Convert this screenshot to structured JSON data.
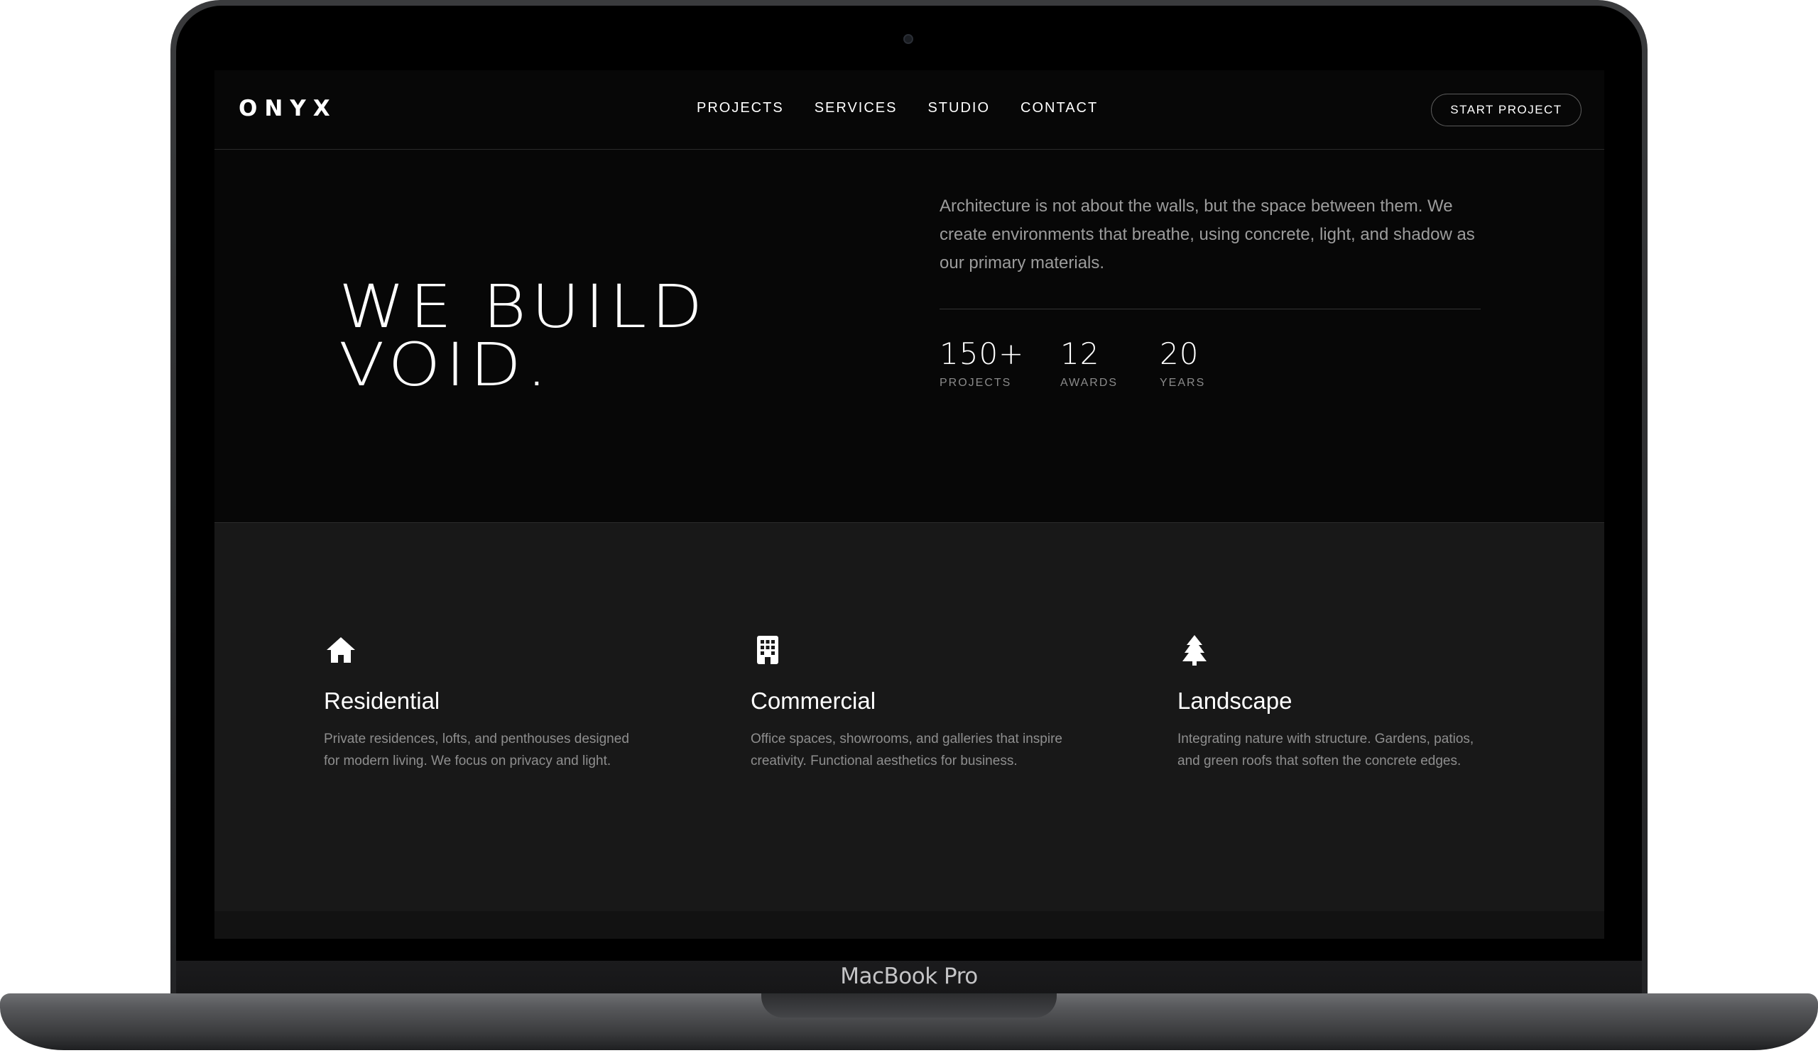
{
  "device": {
    "model_label": "MacBook Pro"
  },
  "nav": {
    "logo": "ONYX",
    "links": [
      "PROJECTS",
      "SERVICES",
      "STUDIO",
      "CONTACT"
    ],
    "cta": "START PROJECT"
  },
  "hero": {
    "title": "WE BUILD\nVOID.",
    "description": "Architecture is not about the walls, but the space between them. We create environments that breathe, using concrete, light, and shadow as our primary materials.",
    "stats": [
      {
        "value": "150+",
        "label": "PROJECTS"
      },
      {
        "value": "12",
        "label": "AWARDS"
      },
      {
        "value": "20",
        "label": "YEARS"
      }
    ]
  },
  "services": [
    {
      "icon": "house-icon",
      "title": "Residential",
      "description": "Private residences, lofts, and penthouses designed for modern living. We focus on privacy and light."
    },
    {
      "icon": "building-icon",
      "title": "Commercial",
      "description": "Office spaces, showrooms, and galleries that inspire creativity. Functional aesthetics for business."
    },
    {
      "icon": "tree-icon",
      "title": "Landscape",
      "description": "Integrating nature with structure. Gardens, patios, and green roofs that soften the concrete edges."
    }
  ]
}
